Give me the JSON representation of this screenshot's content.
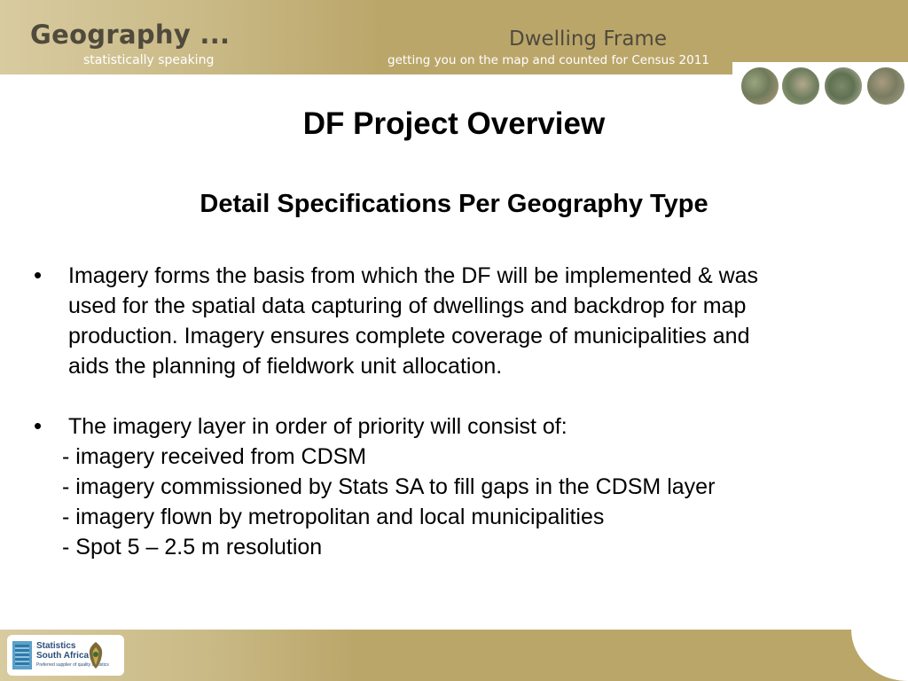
{
  "header": {
    "brand": "Geography ...",
    "brand_sub": "statistically speaking",
    "title": "Dwelling Frame",
    "subtitle": "getting you on the map and counted for Census 2011"
  },
  "slide": {
    "title": "DF Project Overview",
    "subtitle": "Detail Specifications Per Geography Type",
    "bullets": [
      {
        "marker": "•",
        "lines": [
          "Imagery forms the basis from which the DF will be implemented & was",
          "used for the spatial data capturing of dwellings and backdrop for map",
          "production. Imagery ensures complete coverage of municipalities and",
          "aids the planning of fieldwork unit allocation."
        ]
      },
      {
        "marker": "•",
        "lines": [
          "The imagery layer in order of priority will consist of:"
        ],
        "sub_items": [
          "- imagery received from CDSM",
          "- imagery commissioned by Stats SA to fill gaps in the CDSM layer",
          "- imagery flown by metropolitan and local municipalities",
          "- Spot 5 – 2.5 m resolution"
        ]
      }
    ]
  },
  "footer": {
    "logo_line1": "Statistics",
    "logo_line2": "South Africa",
    "logo_tag": "Preferred supplier of quality statistics"
  },
  "colors": {
    "band": "#bba66a",
    "brand_text": "#4f4a3c"
  },
  "icons": [
    "aerial-photo",
    "stats-sa-logo",
    "coat-of-arms-icon"
  ]
}
